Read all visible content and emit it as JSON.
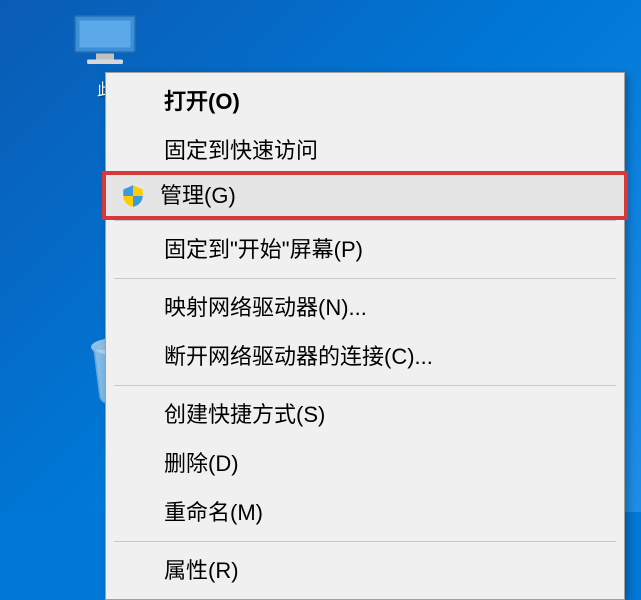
{
  "desktop": {
    "icon_label": "此",
    "computer_icon_name": "this-pc-icon",
    "recycle_icon_name": "recycle-bin-icon"
  },
  "context_menu": {
    "items": [
      {
        "label": "打开(O)",
        "bold": true,
        "separator_after": false
      },
      {
        "label": "固定到快速访问",
        "separator_after": false
      },
      {
        "label": "管理(G)",
        "icon": "shield",
        "highlighted": true,
        "separator_after": true
      },
      {
        "label": "固定到\"开始\"屏幕(P)",
        "separator_after": true
      },
      {
        "label": "映射网络驱动器(N)...",
        "separator_after": false
      },
      {
        "label": "断开网络驱动器的连接(C)...",
        "separator_after": true
      },
      {
        "label": "创建快捷方式(S)",
        "separator_after": false
      },
      {
        "label": "删除(D)",
        "separator_after": false
      },
      {
        "label": "重命名(M)",
        "separator_after": true
      },
      {
        "label": "属性(R)",
        "separator_after": false
      }
    ]
  }
}
